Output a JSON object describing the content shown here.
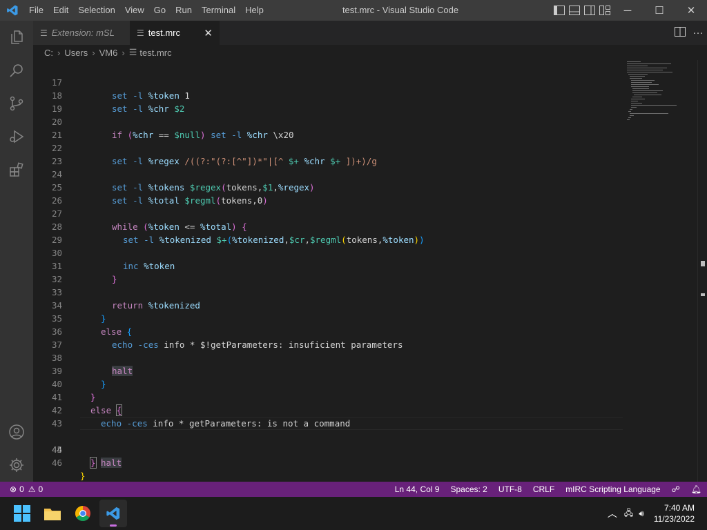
{
  "titlebar": {
    "menu": [
      "File",
      "Edit",
      "Selection",
      "View",
      "Go",
      "Run",
      "Terminal",
      "Help"
    ],
    "title": "test.mrc - Visual Studio Code",
    "win_min": "─",
    "win_max": "☐",
    "win_close": "✕"
  },
  "tabs": [
    {
      "label": "Extension: mSL",
      "icon": "preview-icon"
    },
    {
      "label": "test.mrc",
      "icon": "file-lines-icon",
      "close": "✕"
    }
  ],
  "breadcrumb": [
    "C:",
    "Users",
    "VM6",
    "test.mrc"
  ],
  "editor": {
    "current_line": 44,
    "lines": [
      {
        "n": "17"
      },
      {
        "n": "18"
      },
      {
        "n": "19"
      },
      {
        "n": "20"
      },
      {
        "n": "21"
      },
      {
        "n": "22"
      },
      {
        "n": "23"
      },
      {
        "n": "24"
      },
      {
        "n": "25"
      },
      {
        "n": "26"
      },
      {
        "n": "27"
      },
      {
        "n": "28"
      },
      {
        "n": "29"
      },
      {
        "n": "30"
      },
      {
        "n": "31"
      },
      {
        "n": "32"
      },
      {
        "n": "33"
      },
      {
        "n": "34"
      },
      {
        "n": "35"
      },
      {
        "n": "36"
      },
      {
        "n": "37"
      },
      {
        "n": "38"
      },
      {
        "n": "39"
      },
      {
        "n": "40"
      },
      {
        "n": "41"
      },
      {
        "n": "42"
      },
      {
        "n": "43"
      },
      {
        "n": "44"
      },
      {
        "n": "45"
      },
      {
        "n": "46"
      }
    ],
    "tokens": {
      "set": "set",
      "flag": "-l",
      "token": "%token",
      "one": "1",
      "chr": "%chr",
      "d2": "$2",
      "if": "if",
      "null": "$null",
      "x20": "\\x20",
      "regex_v": "%regex",
      "regex_body1": "/((?:\"(?:[^\"])*\"|[^ ",
      "plus": "$+",
      "regex_body2": " ])+)/g",
      "tokens_v": "%tokens",
      "regex_fn": "$regex",
      "tokens_w": "tokens",
      "d1": "$1",
      "total": "%total",
      "regml": "$regml",
      "zero": "0",
      "while": "while",
      "lte": "<=",
      "tokenized": "%tokenized",
      "cr": "$cr",
      "inc": "inc",
      "return": "return",
      "else": "else",
      "echo": "echo",
      "ces": "-ces",
      "info": "info",
      "star": "*",
      "msg36": "$!getParameters: insuficient parameters",
      "halt": "halt",
      "msg42": "getParameters: is not a command",
      "obrace": "{",
      "cbrace": "}",
      "eq": "==",
      "bar": "|"
    }
  },
  "status": {
    "errors": "0",
    "warnings": "0",
    "position": "Ln 44, Col 9",
    "spaces": "Spaces: 2",
    "encoding": "UTF-8",
    "eol": "CRLF",
    "language": "mIRC Scripting Language"
  },
  "taskbar": {
    "time": "7:40 AM",
    "date": "11/23/2022"
  },
  "colors": {
    "statusbar": "#68217a",
    "editor_bg": "#1e1e1e",
    "titlebar": "#3c3c3c",
    "activitybar": "#333333"
  }
}
